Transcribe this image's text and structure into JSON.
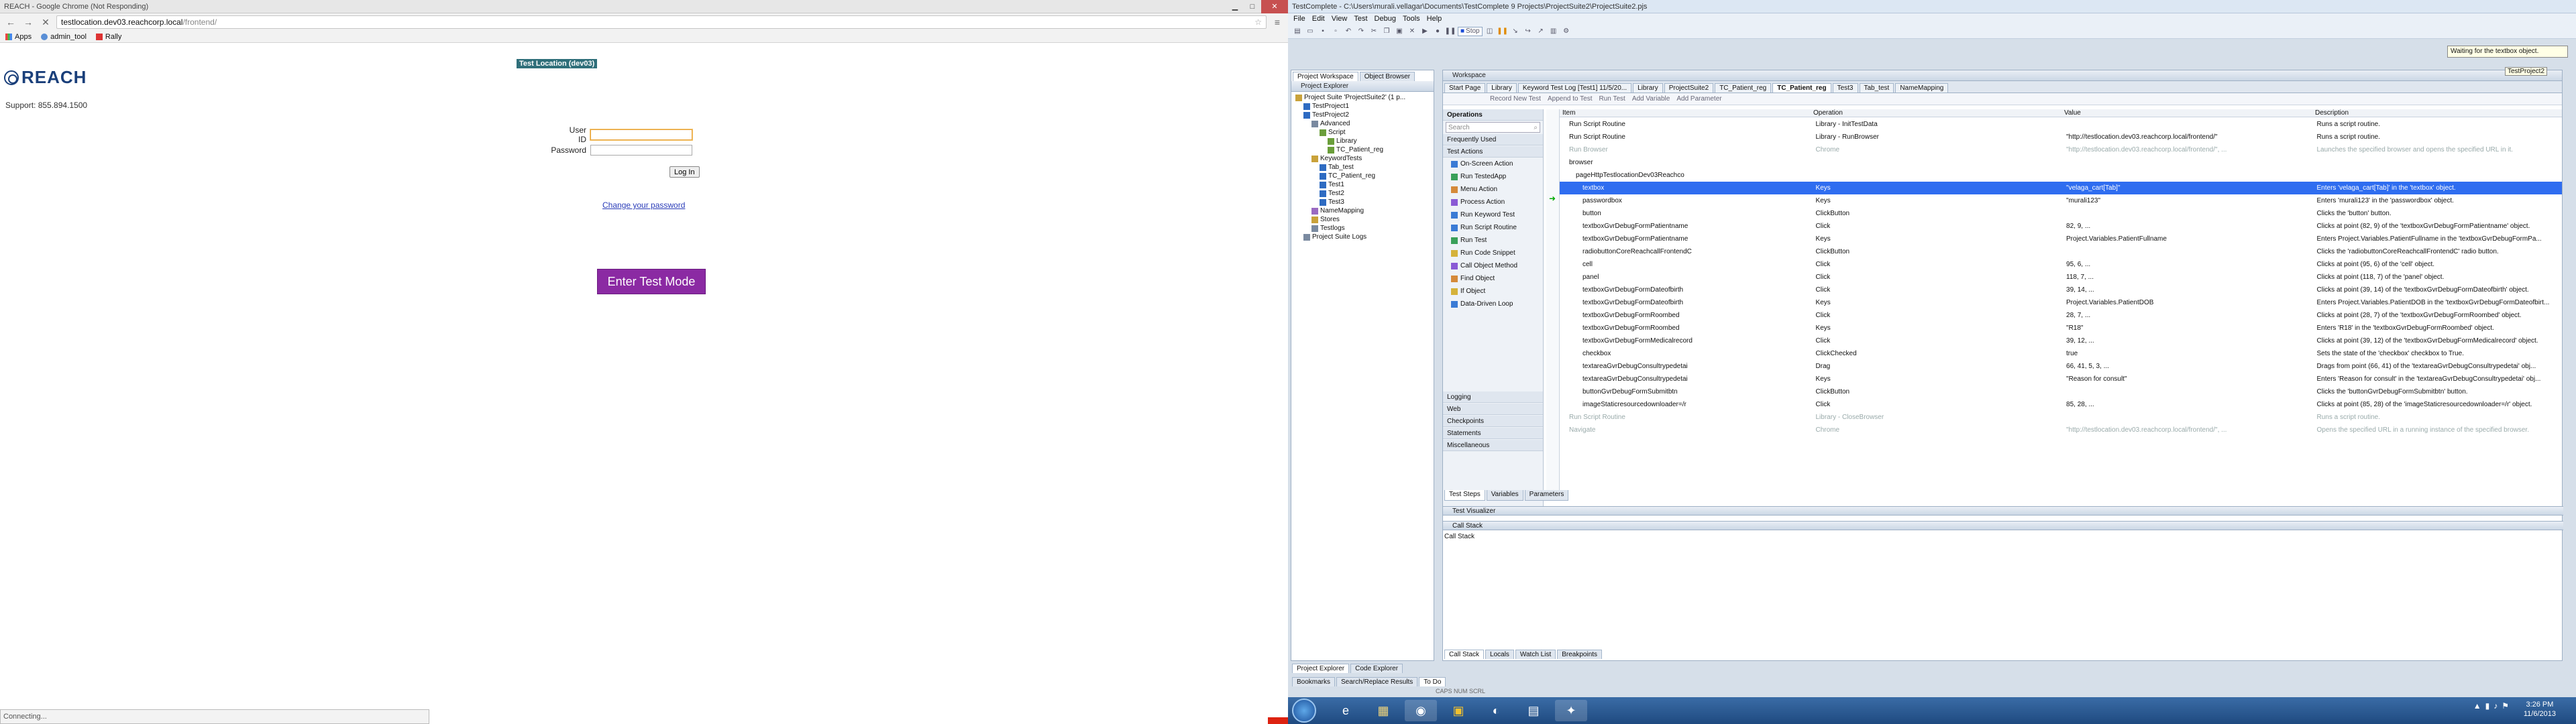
{
  "chrome": {
    "window_title": "REACH - Google Chrome (Not Responding)",
    "url_host": "testlocation.dev03.reachcorp.local",
    "url_path": "/frontend/",
    "bookmarks": [
      "Apps",
      "admin_tool",
      "Rally"
    ],
    "env_banner": "Test Location (dev03)",
    "logo_text": "REACH",
    "support": "Support: 855.894.1500",
    "user_id_label": "User ID",
    "password_label": "Password",
    "login_button": "Log In",
    "change_password": "Change your password",
    "test_mode_button": "Enter Test Mode",
    "status": "Connecting..."
  },
  "tc": {
    "title": "TestComplete - C:\\Users\\murali.vellagar\\Documents\\TestComplete 9 Projects\\ProjectSuite2\\ProjectSuite2.pjs",
    "menu": [
      "File",
      "Edit",
      "View",
      "Test",
      "Debug",
      "Tools",
      "Help"
    ],
    "stop_label": "Stop",
    "tooltip": "Waiting for the textbox object.",
    "tooltip2": "TestProject2",
    "project_explorer": {
      "head": "Project Explorer",
      "tabs": [
        "Project Workspace",
        "Object Browser"
      ],
      "tree": [
        {
          "label": "Project Suite 'ProjectSuite2' (1 p...",
          "indent": 0
        },
        {
          "label": "TestProject1",
          "indent": 1
        },
        {
          "label": "TestProject2",
          "indent": 1
        },
        {
          "label": "Advanced",
          "indent": 2
        },
        {
          "label": "Script",
          "indent": 3
        },
        {
          "label": "Library",
          "indent": 4
        },
        {
          "label": "TC_Patient_reg",
          "indent": 4
        },
        {
          "label": "KeywordTests",
          "indent": 2
        },
        {
          "label": "Tab_test",
          "indent": 3
        },
        {
          "label": "TC_Patient_reg",
          "indent": 3
        },
        {
          "label": "Test1",
          "indent": 3
        },
        {
          "label": "Test2",
          "indent": 3
        },
        {
          "label": "Test3",
          "indent": 3
        },
        {
          "label": "NameMapping",
          "indent": 2
        },
        {
          "label": "Stores",
          "indent": 2
        },
        {
          "label": "Testlogs",
          "indent": 2
        },
        {
          "label": "Project Suite Logs",
          "indent": 1
        }
      ],
      "bottom_tabs": [
        "Project Explorer",
        "Code Explorer"
      ]
    },
    "workspace": {
      "head": "Workspace",
      "tabs": [
        "Start Page",
        "Library",
        "Keyword Test Log [Test1] 11/5/20...",
        "Library",
        "ProjectSuite2",
        "TC_Patient_reg",
        "TC_Patient_reg",
        "Test3",
        "Tab_test",
        "NameMapping"
      ],
      "toolbar": [
        "Record New Test",
        "Append to Test",
        "Run Test",
        "Add Variable",
        "Add Parameter"
      ],
      "operations_head": "Operations",
      "search_placeholder": "Search",
      "categories_top": [
        "Frequently Used",
        "Test Actions"
      ],
      "operations": [
        "On-Screen Action",
        "Run TestedApp",
        "Menu Action",
        "Process Action",
        "Run Keyword Test",
        "Run Script Routine",
        "Run Test",
        "Run Code Snippet",
        "Call Object Method",
        "Find Object",
        "If Object",
        "Data-Driven Loop"
      ],
      "categories_bottom": [
        "Logging",
        "Web",
        "Checkpoints",
        "Statements",
        "Miscellaneous"
      ],
      "columns": [
        "Item",
        "Operation",
        "Value",
        "Description"
      ],
      "rows": [
        {
          "item": "Run Script Routine",
          "op": "Library - InitTestData",
          "val": "",
          "desc": "Runs a script routine.",
          "ind": 1,
          "sel": false,
          "muted": false
        },
        {
          "item": "Run Script Routine",
          "op": "Library - RunBrowser",
          "val": "\"http://testlocation.dev03.reachcorp.local/frontend/\"",
          "desc": "Runs a script routine.",
          "ind": 1,
          "sel": false,
          "muted": false
        },
        {
          "item": "Run Browser",
          "op": "Chrome",
          "val": "\"http://testlocation.dev03.reachcorp.local/frontend/\", ...",
          "desc": "Launches the specified browser and opens the specified URL in it.",
          "ind": 1,
          "sel": false,
          "muted": true
        },
        {
          "item": "browser",
          "op": "",
          "val": "",
          "desc": "",
          "ind": 1,
          "sel": false,
          "muted": false
        },
        {
          "item": "pageHttpTestlocationDev03Reachco",
          "op": "",
          "val": "",
          "desc": "",
          "ind": 2,
          "sel": false,
          "muted": false
        },
        {
          "item": "textbox",
          "op": "Keys",
          "val": "\"velaga_cart[Tab]\"",
          "desc": "Enters 'velaga_cart[Tab]' in the 'textbox' object.",
          "ind": 3,
          "sel": true,
          "muted": false
        },
        {
          "item": "passwordbox",
          "op": "Keys",
          "val": "\"murali123\"",
          "desc": "Enters 'murali123' in the 'passwordbox' object.",
          "ind": 3,
          "sel": false,
          "muted": false
        },
        {
          "item": "button",
          "op": "ClickButton",
          "val": "",
          "desc": "Clicks the 'button' button.",
          "ind": 3,
          "sel": false,
          "muted": false
        },
        {
          "item": "textboxGvrDebugFormPatientname",
          "op": "Click",
          "val": "82, 9, ...",
          "desc": "Clicks at point (82, 9) of the 'textboxGvrDebugFormPatientname' object.",
          "ind": 3,
          "sel": false,
          "muted": false
        },
        {
          "item": "textboxGvrDebugFormPatientname",
          "op": "Keys",
          "val": "Project.Variables.PatientFullname",
          "desc": "Enters Project.Variables.PatientFullname in the 'textboxGvrDebugFormPa...",
          "ind": 3,
          "sel": false,
          "muted": false
        },
        {
          "item": "radiobuttonCoreReachcallFrontendC",
          "op": "ClickButton",
          "val": "",
          "desc": "Clicks the 'radiobuttonCoreReachcallFrontendC' radio button.",
          "ind": 3,
          "sel": false,
          "muted": false
        },
        {
          "item": "cell",
          "op": "Click",
          "val": "95, 6, ...",
          "desc": "Clicks at point (95, 6) of the 'cell' object.",
          "ind": 3,
          "sel": false,
          "muted": false
        },
        {
          "item": "panel",
          "op": "Click",
          "val": "118, 7, ...",
          "desc": "Clicks at point (118, 7) of the 'panel' object.",
          "ind": 3,
          "sel": false,
          "muted": false
        },
        {
          "item": "textboxGvrDebugFormDateofbirth",
          "op": "Click",
          "val": "39, 14, ...",
          "desc": "Clicks at point (39, 14) of the 'textboxGvrDebugFormDateofbirth' object.",
          "ind": 3,
          "sel": false,
          "muted": false
        },
        {
          "item": "textboxGvrDebugFormDateofbirth",
          "op": "Keys",
          "val": "Project.Variables.PatientDOB",
          "desc": "Enters Project.Variables.PatientDOB in the 'textboxGvrDebugFormDateofbirt...",
          "ind": 3,
          "sel": false,
          "muted": false
        },
        {
          "item": "textboxGvrDebugFormRoombed",
          "op": "Click",
          "val": "28, 7, ...",
          "desc": "Clicks at point (28, 7) of the 'textboxGvrDebugFormRoombed' object.",
          "ind": 3,
          "sel": false,
          "muted": false
        },
        {
          "item": "textboxGvrDebugFormRoombed",
          "op": "Keys",
          "val": "\"R18\"",
          "desc": "Enters 'R18' in the 'textboxGvrDebugFormRoombed' object.",
          "ind": 3,
          "sel": false,
          "muted": false
        },
        {
          "item": "textboxGvrDebugFormMedicalrecord",
          "op": "Click",
          "val": "39, 12, ...",
          "desc": "Clicks at point (39, 12) of the 'textboxGvrDebugFormMedicalrecord' object.",
          "ind": 3,
          "sel": false,
          "muted": false
        },
        {
          "item": "checkbox",
          "op": "ClickChecked",
          "val": "true",
          "desc": "Sets the state of the 'checkbox' checkbox to True.",
          "ind": 3,
          "sel": false,
          "muted": false
        },
        {
          "item": "textareaGvrDebugConsultrypedetai",
          "op": "Drag",
          "val": "66, 41, 5, 3, ...",
          "desc": "Drags from point (66, 41) of the 'textareaGvrDebugConsultrypedetai' obj...",
          "ind": 3,
          "sel": false,
          "muted": false
        },
        {
          "item": "textareaGvrDebugConsultrypedetai",
          "op": "Keys",
          "val": "\"Reason for consult\"",
          "desc": "Enters 'Reason for consult' in the 'textareaGvrDebugConsultrypedetai' obj...",
          "ind": 3,
          "sel": false,
          "muted": false
        },
        {
          "item": "buttonGvrDebugFormSubmitbtn",
          "op": "ClickButton",
          "val": "",
          "desc": "Clicks the 'buttonGvrDebugFormSubmitbtn' button.",
          "ind": 3,
          "sel": false,
          "muted": false
        },
        {
          "item": "imageStaticresourcedownloader=/r",
          "op": "Click",
          "val": "85, 28, ...",
          "desc": "Clicks at point (85, 28) of the 'imageStaticresourcedownloader=/r' object.",
          "ind": 3,
          "sel": false,
          "muted": false
        },
        {
          "item": "Run Script Routine",
          "op": "Library - CloseBrowser",
          "val": "",
          "desc": "Runs a script routine.",
          "ind": 1,
          "sel": false,
          "muted": true
        },
        {
          "item": "Navigate",
          "op": "Chrome",
          "val": "\"http://testlocation.dev03.reachcorp.local/frontend/\", ...",
          "desc": "Opens the specified URL in a running instance of the specified browser.",
          "ind": 1,
          "sel": false,
          "muted": true
        }
      ],
      "bottom_tabs": [
        "Test Steps",
        "Variables",
        "Parameters"
      ],
      "test_visualizer": "Test Visualizer",
      "call_stack_head": "Call Stack",
      "call_stack_label": "Call Stack",
      "debug_tabs": [
        "Call Stack",
        "Locals",
        "Watch List",
        "Breakpoints"
      ]
    },
    "bottom_tabs": [
      "Bookmarks",
      "Search/Replace Results",
      "To Do"
    ],
    "status_bar": "CAPS  NUM  SCRL"
  },
  "taskbar": {
    "time": "3:26 PM",
    "date": "11/6/2013"
  }
}
